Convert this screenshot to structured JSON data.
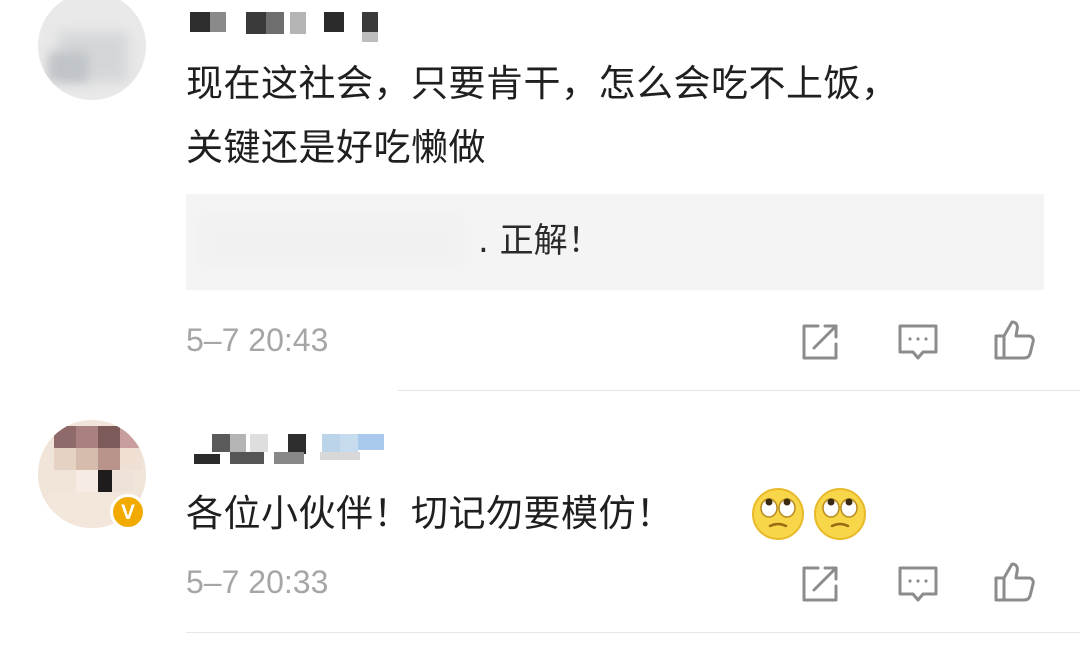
{
  "comments": [
    {
      "text_line1": "现在这社会，只要肯干，怎么会吃不上饭，",
      "text_line2": "关键还是好吃懒做",
      "reply_mark": ".",
      "reply_text": "正解！",
      "time": "5–7 20:43",
      "actions": [
        "share-icon",
        "comment-icon",
        "like-icon"
      ]
    },
    {
      "text": "各位小伙伴！切记勿要模仿！",
      "verified_badge": "V",
      "emojis": [
        "eye-roll-emoji",
        "eye-roll-emoji"
      ],
      "time": "5–7 20:33",
      "actions": [
        "share-icon",
        "comment-icon",
        "like-icon"
      ]
    }
  ],
  "colors": {
    "text": "#1f1f1f",
    "timestamp": "#a6a6a6",
    "icon": "#8c8c8c",
    "quote_bg": "#f4f4f4",
    "verified": "#f2a900",
    "divider": "#e6e6e6"
  }
}
